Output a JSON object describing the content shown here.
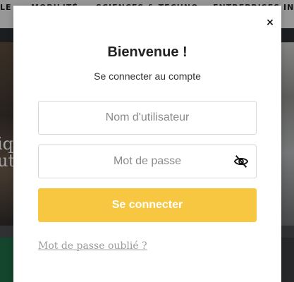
{
  "background": {
    "nav_items": [
      "LE",
      "MOBILITÉ",
      "SCIENCES & TECHNO",
      "ENTREPRISES INN"
    ],
    "hero_text": "iq\nut"
  },
  "modal": {
    "close_label": "×",
    "title": "Bienvenue !",
    "subtitle": "Se connecter au compte",
    "username": {
      "placeholder": "Nom d'utilisateur",
      "value": ""
    },
    "password": {
      "placeholder": "Mot de passe",
      "value": ""
    },
    "toggle_password_icon": "eye-slash-icon",
    "submit_label": "Se connecter",
    "forgot_label": "Mot de passe oublié ?"
  },
  "colors": {
    "accent": "#f8c741",
    "link": "#9a9a9a"
  }
}
